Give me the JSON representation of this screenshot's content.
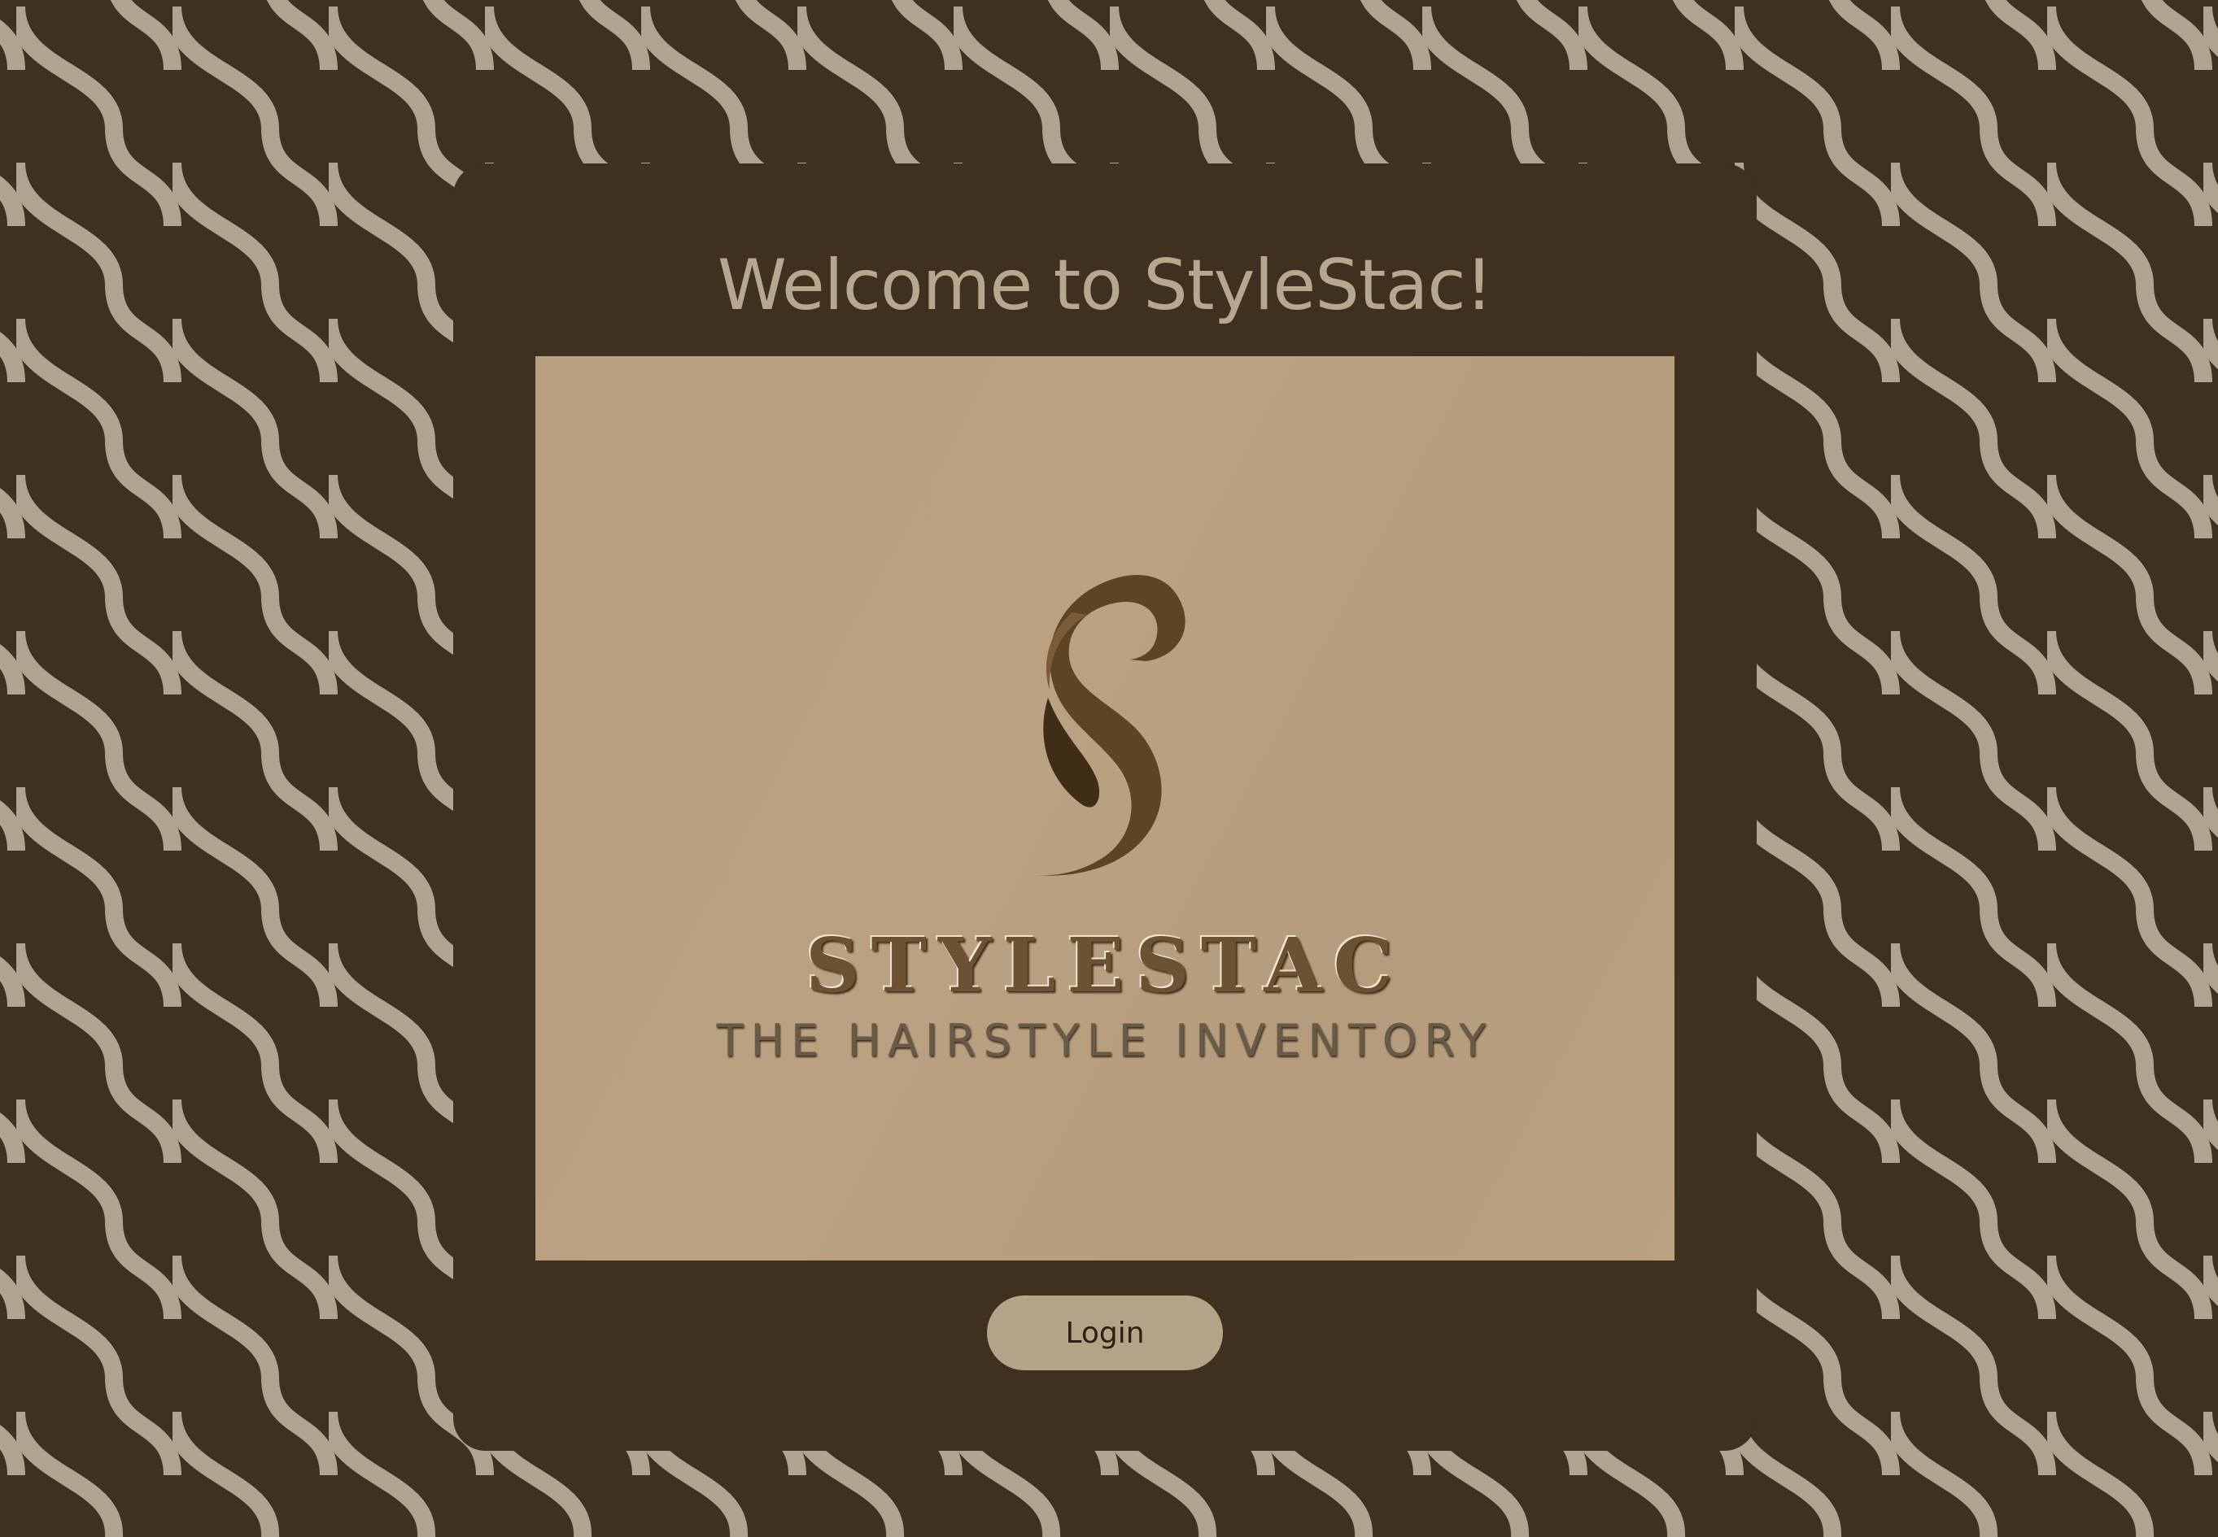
{
  "page": {
    "welcome_title": "Welcome to StyleStac!"
  },
  "logo": {
    "wordmark": "STYLESTAC",
    "tagline": "THE HAIRSTYLE INVENTORY"
  },
  "actions": {
    "login_label": "Login"
  },
  "colors": {
    "background": "#3e311f",
    "wave_pattern": "#b0a38f",
    "title_text": "#b7a78f",
    "logo_background": "#b9a080",
    "logo_mark": "#5e4426",
    "button_background": "#b5a387",
    "button_text": "#2c2214"
  },
  "icons": {
    "logo_mark": "stylized-s-hair-curl-icon",
    "background_pattern": "wave-pattern"
  }
}
